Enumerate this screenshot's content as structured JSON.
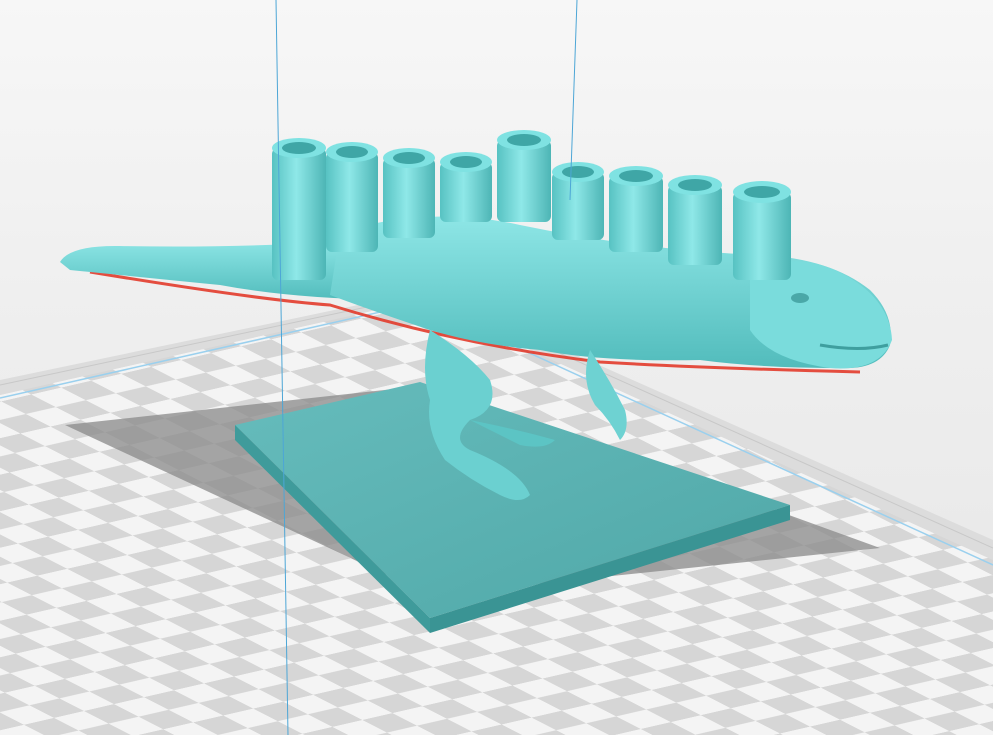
{
  "viewport": {
    "view": "3d-slicer-preview",
    "background": "#eeeeee",
    "build_plate": {
      "light_tile": "#f4f4f4",
      "dark_tile": "#d4d4d4",
      "border": "#cfcfcf",
      "edge_line": "#8fc9ea"
    },
    "print_area_lines": "#4da6d6"
  },
  "model": {
    "description_icon": "t-rex-menorah-model",
    "color": "#6fd6d6",
    "shade": "#4fb3b3",
    "overhang_color": "#e23b2b",
    "candle_holders": 9
  },
  "platform": {
    "icon": "rectangular-base-plate",
    "top_color": "#5ab0b0",
    "side_color": "#3e9a9a"
  }
}
